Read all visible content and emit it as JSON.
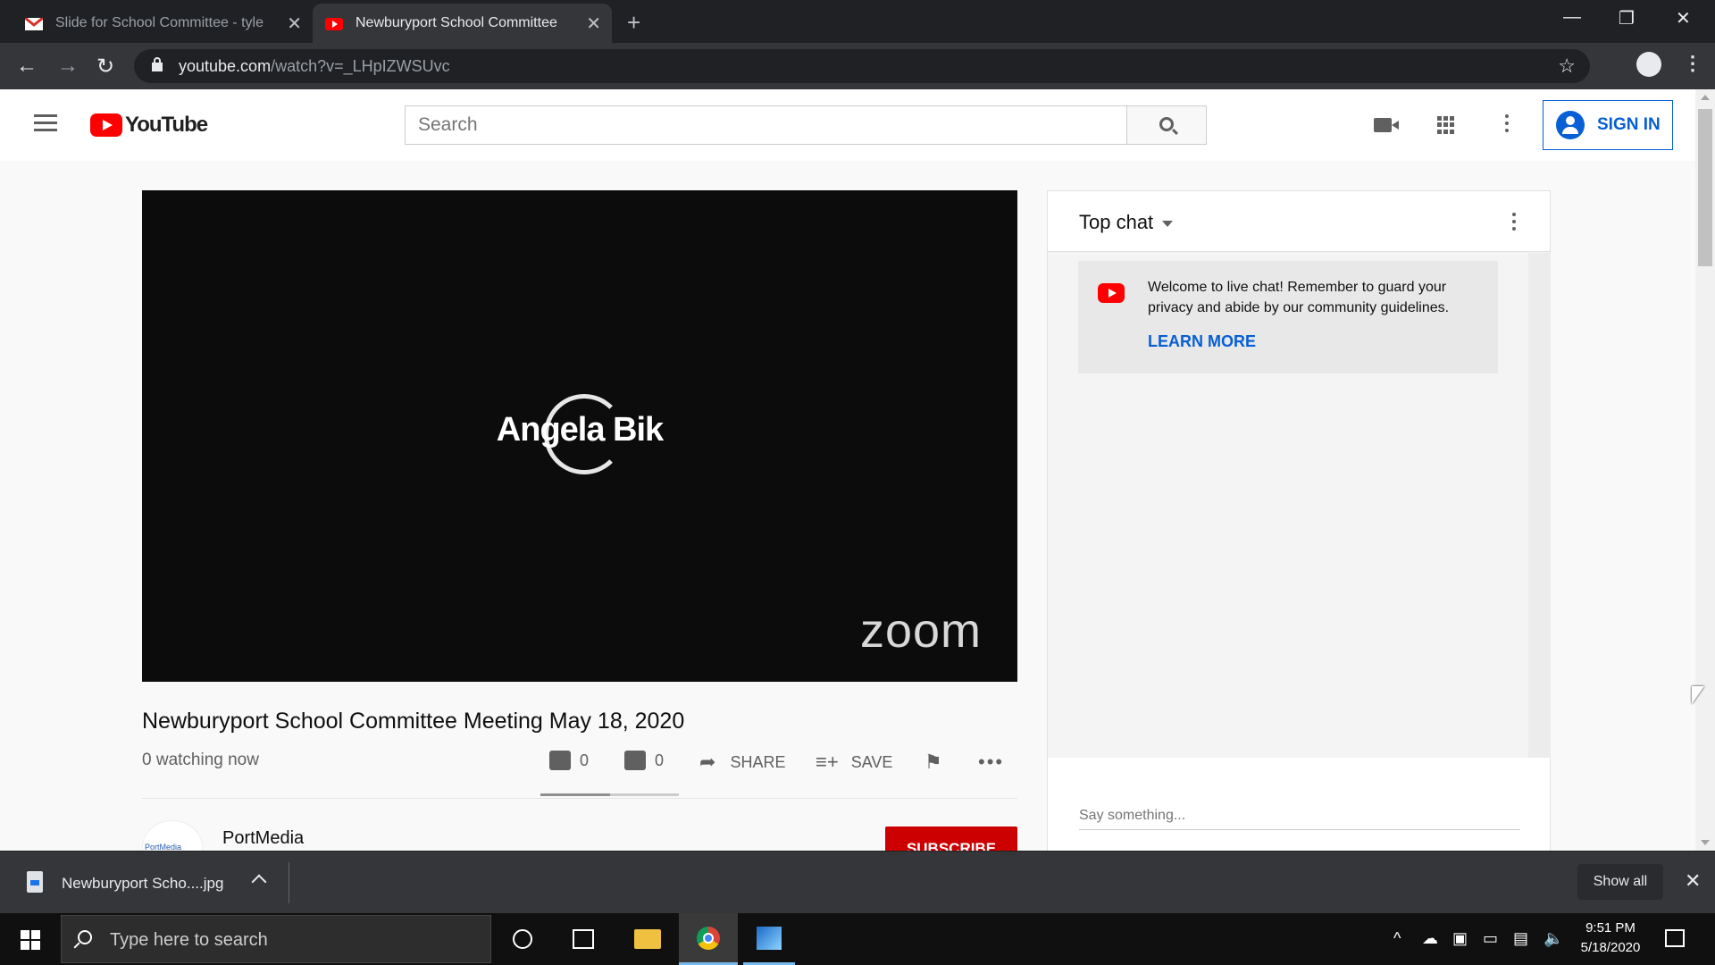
{
  "browser": {
    "tabs": [
      {
        "title": "Slide for School Committee - tyle",
        "active": false
      },
      {
        "title": "Newburyport School Committee",
        "active": true
      }
    ],
    "url_host": "youtube.com",
    "url_path": "/watch?v=_LHpIZWSUvc"
  },
  "youtube": {
    "logo_text": "YouTube",
    "search_placeholder": "Search",
    "sign_in_label": "SIGN IN"
  },
  "video": {
    "speaker_name": "Angela Bik",
    "watermark": "zoom",
    "title": "Newburyport School Committee Meeting May 18, 2020",
    "watching": "0 watching now",
    "likes": "0",
    "dislikes": "0",
    "share_label": "SHARE",
    "save_label": "SAVE",
    "like_ratio": 0.5
  },
  "channel": {
    "name": "PortMedia",
    "avatar_text": "PortMedia",
    "subscribe_label": "SUBSCRIBE"
  },
  "chat": {
    "header": "Top chat",
    "welcome_text": "Welcome to live chat! Remember to guard your privacy and abide by our community guidelines.",
    "learn_more": "LEARN MORE",
    "input_placeholder": "Say something..."
  },
  "downloads": {
    "file_name": "Newburyport Scho....jpg",
    "show_all": "Show all"
  },
  "taskbar": {
    "search_placeholder": "Type here to search",
    "time": "9:51 PM",
    "date": "5/18/2020"
  },
  "colors": {
    "youtube_red": "#ff0000",
    "link_blue": "#065fd4",
    "subscribe_red": "#cc0000"
  }
}
